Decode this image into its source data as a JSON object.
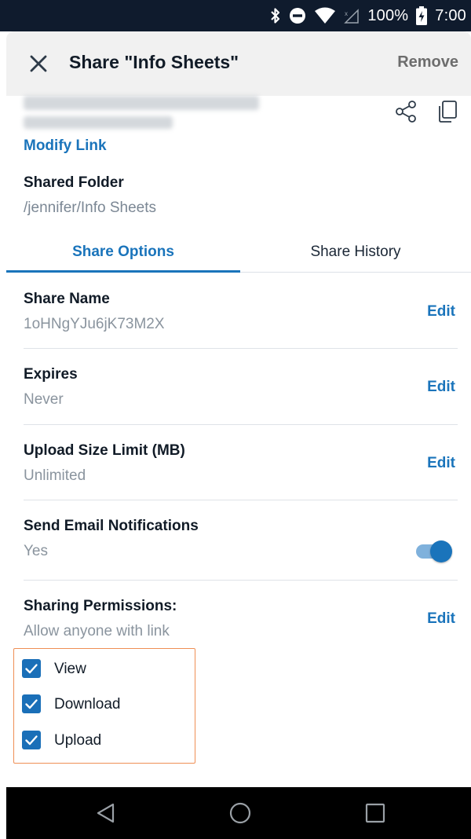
{
  "status_bar": {
    "battery": "100%",
    "time": "7:00",
    "icons": [
      "bluetooth-icon",
      "do-not-disturb-icon",
      "wifi-icon",
      "signal-icon",
      "battery-charging-icon"
    ]
  },
  "header": {
    "title": "Share \"Info Sheets\"",
    "remove_label": "Remove"
  },
  "link": {
    "modify_label": "Modify Link"
  },
  "shared_folder": {
    "label": "Shared Folder",
    "path": "/jennifer/Info Sheets"
  },
  "tabs": [
    {
      "label": "Share Options",
      "active": true
    },
    {
      "label": "Share History",
      "active": false
    }
  ],
  "rows": {
    "share_name": {
      "title": "Share Name",
      "value": "1oHNgYJu6jK73M2X",
      "action": "Edit"
    },
    "expires": {
      "title": "Expires",
      "value": "Never",
      "action": "Edit"
    },
    "upload_limit": {
      "title": "Upload Size Limit (MB)",
      "value": "Unlimited",
      "action": "Edit"
    },
    "email_notifications": {
      "title": "Send Email Notifications",
      "value": "Yes",
      "toggle_on": true
    },
    "permissions": {
      "title": "Sharing Permissions:",
      "value": "Allow anyone with link",
      "action": "Edit"
    }
  },
  "permissions": [
    {
      "label": "View",
      "checked": true
    },
    {
      "label": "Download",
      "checked": true
    },
    {
      "label": "Upload",
      "checked": true
    }
  ],
  "colors": {
    "accent": "#1a74bb",
    "status_bar": "#0f1b2d",
    "highlight_box": "#ef8f55"
  }
}
